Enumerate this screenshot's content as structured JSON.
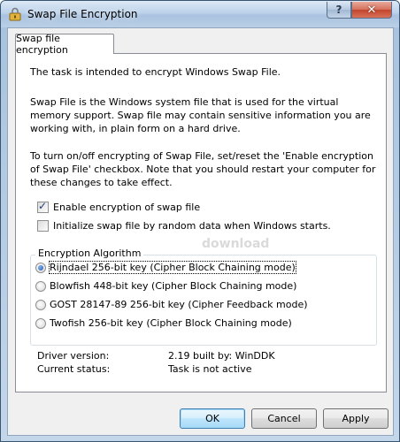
{
  "window": {
    "title": "Swap File Encryption",
    "help_label": "?",
    "close_label": "✕"
  },
  "tabs": [
    {
      "label": "Swap file encryption"
    }
  ],
  "content": {
    "intro": "The task is intended to encrypt Windows Swap File.",
    "description": "Swap File is the Windows system file that is used for the virtual memory support. Swap file may contain sensitive information you are working with, in plain form on a hard drive.",
    "instructions": "To turn on/off encrypting of Swap File, set/reset the 'Enable encryption of Swap File' checkbox. Note that you should restart your computer for these changes to take effect."
  },
  "options": {
    "enable_encryption": {
      "label": "Enable encryption of swap file",
      "checked": true
    },
    "initialize_random": {
      "label": "Initialize swap file by random data when Windows starts.",
      "checked": false
    }
  },
  "algorithm": {
    "group_title": "Encryption Algorithm",
    "items": [
      {
        "label": "Rijndael 256-bit key (Cipher Block Chaining mode)",
        "selected": true
      },
      {
        "label": "Blowfish 448-bit key (Cipher Block Chaining mode)",
        "selected": false
      },
      {
        "label": "GOST 28147-89 256-bit key (Cipher Feedback mode)",
        "selected": false
      },
      {
        "label": "Twofish 256-bit key (Cipher Block Chaining mode)",
        "selected": false
      }
    ]
  },
  "info": {
    "driver_version_label": "Driver version:",
    "driver_version_value": "2.19 built by: WinDDK",
    "status_label": "Current status:",
    "status_value": "Task is not active"
  },
  "buttons": {
    "ok": "OK",
    "cancel": "Cancel",
    "apply": "Apply"
  },
  "watermark": "download"
}
